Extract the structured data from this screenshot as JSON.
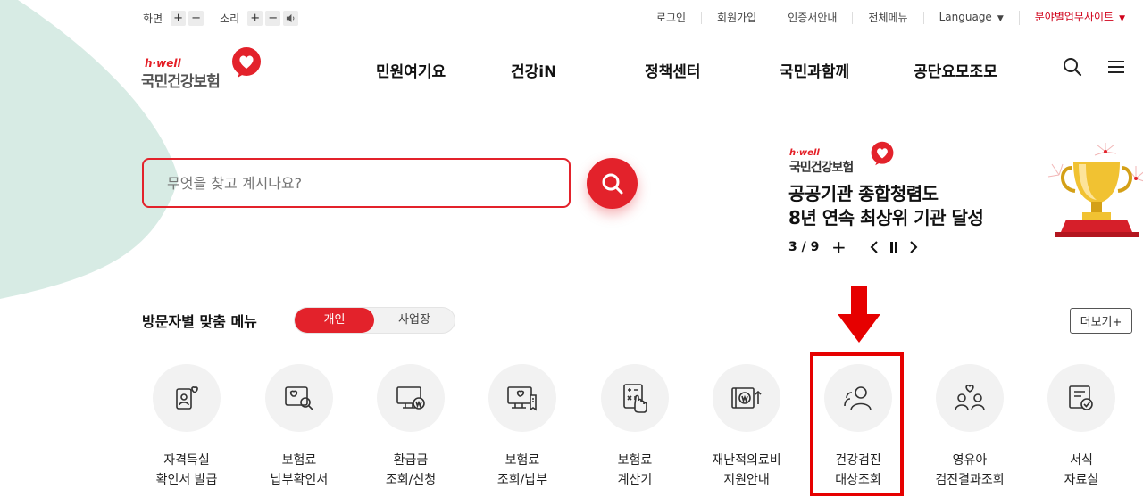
{
  "utilbar": {
    "screen_label": "화면",
    "sound_label": "소리",
    "plus": "+",
    "minus": "−",
    "speaker": "🔈",
    "login": "로그인",
    "signup": "회원가입",
    "cert_guide": "인증서안내",
    "all_menu": "전체메뉴",
    "language": "Language",
    "field_sites": "분야별업무사이트",
    "caret": "▼"
  },
  "logo": {
    "brand": "h·well",
    "name": "국민건강보험"
  },
  "gnb": [
    "민원여기요",
    "건강iN",
    "정책센터",
    "국민과함께",
    "공단요모조모"
  ],
  "search": {
    "placeholder": "무엇을 찾고 계시나요?"
  },
  "banner": {
    "brand": "h·well",
    "name": "국민건강보험",
    "title_line1": "공공기관 종합청렴도",
    "title_line2": "8년 연속 최상위 기관 달성",
    "counter": "3 / 9",
    "plus": "+"
  },
  "section": {
    "title": "방문자별 맞춤 메뉴",
    "tab_personal": "개인",
    "tab_business": "사업장",
    "more": "더보기+"
  },
  "services": [
    {
      "line1": "자격득실",
      "line2": "확인서 발급",
      "icon": "certificate-heart-icon"
    },
    {
      "line1": "보험료",
      "line2": "납부확인서",
      "icon": "payment-search-icon"
    },
    {
      "line1": "환급금",
      "line2": "조회/신청",
      "icon": "refund-monitor-icon"
    },
    {
      "line1": "보험료",
      "line2": "조회/납부",
      "icon": "premium-bill-icon"
    },
    {
      "line1": "보험료",
      "line2": "계산기",
      "icon": "calculator-icon"
    },
    {
      "line1": "재난적의료비",
      "line2": "지원안내",
      "icon": "medical-support-icon"
    },
    {
      "line1": "건강검진",
      "line2": "대상조회",
      "icon": "checkup-person-icon"
    },
    {
      "line1": "영유아",
      "line2": "검진결과조회",
      "icon": "family-heart-icon"
    },
    {
      "line1": "서식",
      "line2": "자료실",
      "icon": "forms-document-icon"
    }
  ],
  "colors": {
    "accent": "#e3222b",
    "highlight": "#e60000",
    "bg_shape": "#d7ebe4"
  }
}
